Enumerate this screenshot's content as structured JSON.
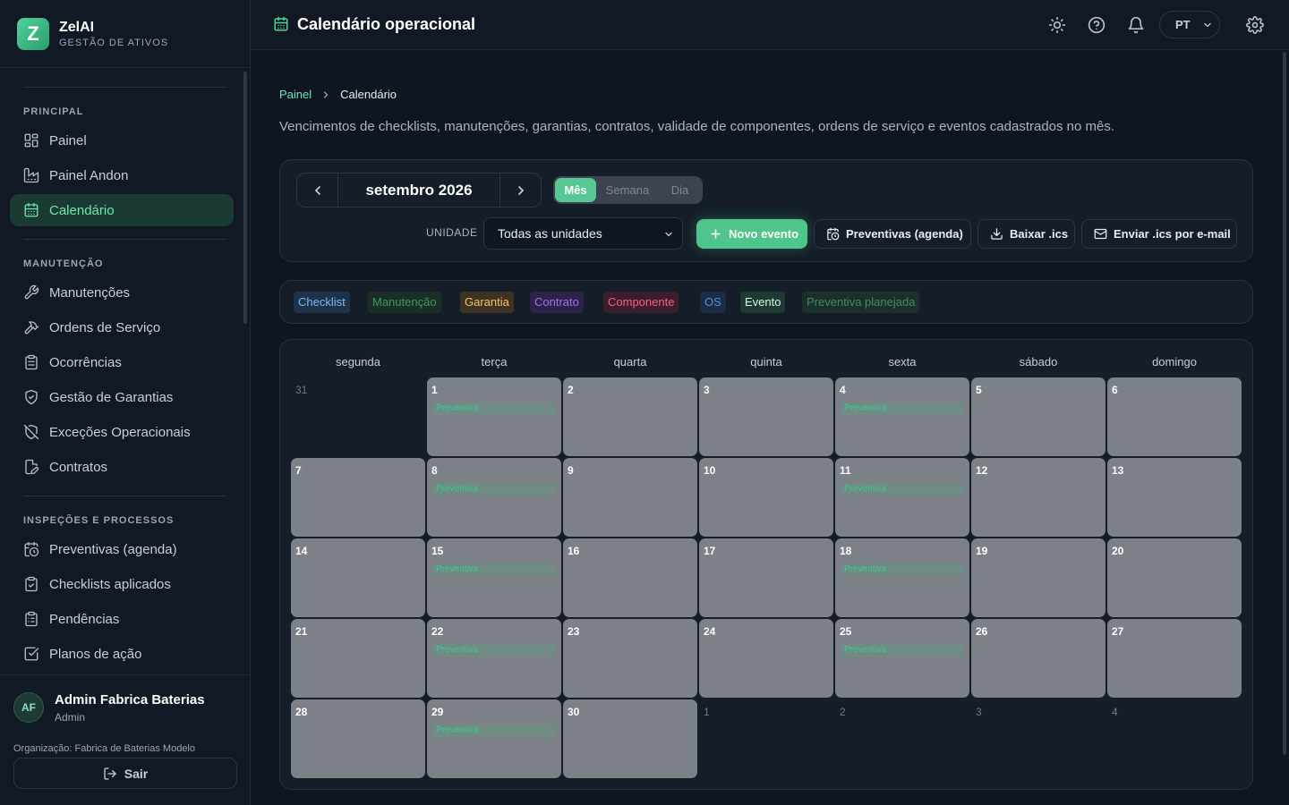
{
  "brand": {
    "name": "ZelAI",
    "subtitle": "GESTÃO DE ATIVOS",
    "logo_letter": "Z"
  },
  "sidebar": {
    "sections": [
      {
        "title": "PRINCIPAL",
        "items": [
          {
            "label": "Painel",
            "icon": "dashboard-icon"
          },
          {
            "label": "Painel Andon",
            "icon": "factory-icon"
          },
          {
            "label": "Calendário",
            "icon": "calendar-icon",
            "active": true
          }
        ]
      },
      {
        "title": "MANUTENÇÃO",
        "items": [
          {
            "label": "Manutenções",
            "icon": "wrench-icon"
          },
          {
            "label": "Ordens de Serviço",
            "icon": "hammer-icon"
          },
          {
            "label": "Ocorrências",
            "icon": "clipboard-icon"
          },
          {
            "label": "Gestão de Garantias",
            "icon": "shield-check-icon"
          },
          {
            "label": "Exceções Operacionais",
            "icon": "shield-off-icon"
          },
          {
            "label": "Contratos",
            "icon": "contract-icon"
          }
        ]
      },
      {
        "title": "INSPEÇÕES E PROCESSOS",
        "items": [
          {
            "label": "Preventivas (agenda)",
            "icon": "calendar-clock-icon"
          },
          {
            "label": "Checklists aplicados",
            "icon": "clipboard-check-icon"
          },
          {
            "label": "Pendências",
            "icon": "clipboard-list-icon"
          },
          {
            "label": "Planos de ação",
            "icon": "square-check-icon"
          }
        ]
      }
    ]
  },
  "user": {
    "initials": "AF",
    "name": "Admin Fabrica Baterias",
    "role": "Admin",
    "organization": "Organização: Fabrica de Baterias Modelo",
    "logout_label": "Sair"
  },
  "topbar": {
    "title": "Calendário operacional",
    "language": "PT"
  },
  "breadcrumb": {
    "root": "Painel",
    "current": "Calendário"
  },
  "description": "Vencimentos de checklists, manutenções, garantias, contratos, validade de componentes, ordens de serviço e eventos cadastrados no mês.",
  "toolbar": {
    "month_label": "setembro 2026",
    "views": [
      "Mês",
      "Semana",
      "Dia"
    ],
    "active_view": "Mês",
    "unit_label": "UNIDADE",
    "unit_value": "Todas as unidades",
    "new_event": "Novo evento",
    "preventive_agenda": "Preventivas (agenda)",
    "download_ics": "Baixar .ics",
    "email_ics": "Enviar .ics por e-mail"
  },
  "legend": [
    {
      "label": "Checklist",
      "color": "#7fb6ff",
      "bg": "#1e3348"
    },
    {
      "label": "Manutenção",
      "color": "#3c9a63",
      "bg": "#1a2e26"
    },
    {
      "label": "Garantia",
      "color": "#f2c46b",
      "bg": "#3e3322"
    },
    {
      "label": "Contrato",
      "color": "#a66bff",
      "bg": "#2c2347"
    },
    {
      "label": "Componente",
      "color": "#ff5b8d",
      "bg": "#3a1e2c"
    },
    {
      "label": "OS",
      "color": "#4d8fe8",
      "bg": "#1b2c44"
    },
    {
      "label": "Evento",
      "color": "#d7f5e8",
      "bg": "#1d3a33"
    },
    {
      "label": "Preventiva planejada",
      "color": "#3f8a6d",
      "bg": "#1d2f2a"
    }
  ],
  "calendar": {
    "weekdays": [
      "segunda",
      "terça",
      "quarta",
      "quinta",
      "sexta",
      "sábado",
      "domingo"
    ],
    "event_label": "Preventiva",
    "weeks": [
      [
        {
          "d": "31",
          "in": false
        },
        {
          "d": "1",
          "in": true,
          "ev": true
        },
        {
          "d": "2",
          "in": true
        },
        {
          "d": "3",
          "in": true
        },
        {
          "d": "4",
          "in": true,
          "ev": true
        },
        {
          "d": "5",
          "in": true
        },
        {
          "d": "6",
          "in": true
        }
      ],
      [
        {
          "d": "7",
          "in": true
        },
        {
          "d": "8",
          "in": true,
          "ev": true
        },
        {
          "d": "9",
          "in": true
        },
        {
          "d": "10",
          "in": true
        },
        {
          "d": "11",
          "in": true,
          "ev": true
        },
        {
          "d": "12",
          "in": true
        },
        {
          "d": "13",
          "in": true
        }
      ],
      [
        {
          "d": "14",
          "in": true
        },
        {
          "d": "15",
          "in": true,
          "ev": true
        },
        {
          "d": "16",
          "in": true
        },
        {
          "d": "17",
          "in": true
        },
        {
          "d": "18",
          "in": true,
          "ev": true
        },
        {
          "d": "19",
          "in": true
        },
        {
          "d": "20",
          "in": true
        }
      ],
      [
        {
          "d": "21",
          "in": true
        },
        {
          "d": "22",
          "in": true,
          "ev": true
        },
        {
          "d": "23",
          "in": true
        },
        {
          "d": "24",
          "in": true
        },
        {
          "d": "25",
          "in": true,
          "ev": true
        },
        {
          "d": "26",
          "in": true
        },
        {
          "d": "27",
          "in": true
        }
      ],
      [
        {
          "d": "28",
          "in": true
        },
        {
          "d": "29",
          "in": true,
          "ev": true
        },
        {
          "d": "30",
          "in": true
        },
        {
          "d": "1",
          "in": false
        },
        {
          "d": "2",
          "in": false
        },
        {
          "d": "3",
          "in": false
        },
        {
          "d": "4",
          "in": false
        }
      ]
    ]
  }
}
